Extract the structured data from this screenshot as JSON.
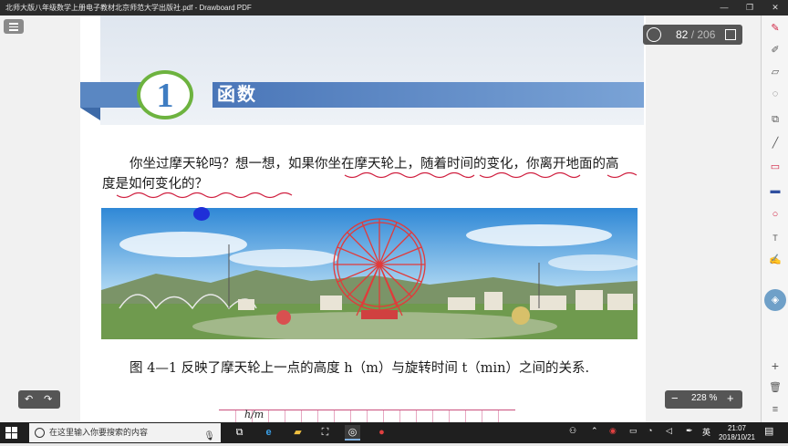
{
  "window": {
    "title": "北师大版八年级数学上册电子教材北京师范大学出版社.pdf - Drawboard PDF",
    "controls": [
      "—",
      "❐",
      "✕"
    ]
  },
  "page_nav": {
    "current": "82",
    "total": "/ 206"
  },
  "zoom": {
    "minus": "−",
    "value": "228 %",
    "plus": "+"
  },
  "history": {
    "undo": "↶",
    "redo": "↷"
  },
  "document": {
    "section_number": "1",
    "section_title": "函数",
    "paragraph1": "你坐过摩天轮吗？想一想，如果你坐在摩天轮上，随着时间的变化，你离开地面的高度是如何变化的？",
    "paragraph2": "图 4—1 反映了摩天轮上一点的高度 h（m）与旋转时间 t（min）之间的关系.",
    "graph_ylabel": "h/m"
  },
  "toolbar": {
    "tools": [
      "pen-icon",
      "highlighter-icon",
      "eraser-icon",
      "lasso-icon",
      "crop-icon",
      "line-icon",
      "rectangle-icon",
      "fill-icon",
      "ellipse-icon",
      "text-icon",
      "signature-icon",
      "nav-wheel-icon",
      "add-icon",
      "delete-icon",
      "more-icon"
    ]
  },
  "taskbar": {
    "search_placeholder": "在这里输入你要搜索的内容",
    "ime": "英",
    "time": "21:07",
    "date": "2018/10/21"
  },
  "colors": {
    "accent": "#3f7dc2",
    "ribbon": "#5a87c2",
    "circle_border": "#6db33f",
    "underline": "#d02040",
    "cursor_dot": "#1f2fd8"
  }
}
